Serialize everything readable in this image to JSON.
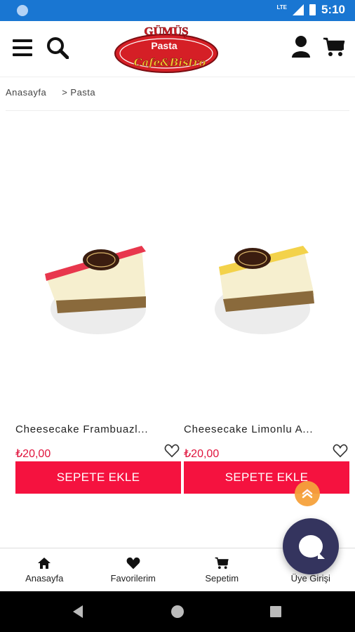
{
  "status_bar": {
    "network": "LTE",
    "time": "5:10"
  },
  "header": {
    "logo_line1": "GÜMÜŞ",
    "logo_line2": "Pasta",
    "logo_line3": "Cafe&Bistro",
    "colors": {
      "logo_red": "#d51f26",
      "logo_gold": "#f2c230"
    }
  },
  "breadcrumb": {
    "home": "Anasayfa",
    "current": "> Pasta"
  },
  "products": [
    {
      "name": "Cheesecake Frambuazl...",
      "price": "₺20,00",
      "button": "SEPETE EKLE",
      "topping_color": "#e8374d"
    },
    {
      "name": "Cheesecake Limonlu A...",
      "price": "₺20,00",
      "button": "SEPETE EKLE",
      "topping_color": "#f3d24a"
    }
  ],
  "bottom_nav": {
    "home": "Anasayfa",
    "favorites": "Favorilerim",
    "cart": "Sepetim",
    "login": "Üye Girişi"
  },
  "colors": {
    "status_bar": "#1976d2",
    "button": "#f5123f",
    "price": "#e0143d",
    "scroll_top": "#f6a23c",
    "chat": "#34345e"
  }
}
